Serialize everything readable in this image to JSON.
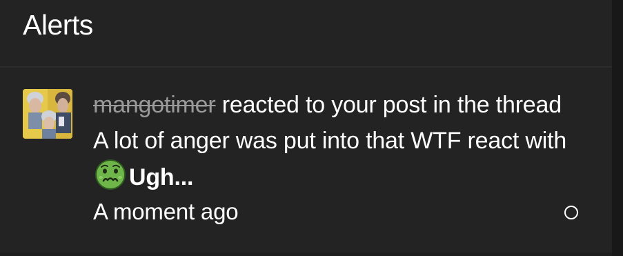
{
  "header": {
    "title": "Alerts"
  },
  "alerts": [
    {
      "username": "mangotimer",
      "text_before_thread": " reacted to your post in the thread ",
      "thread_title": "A lot of anger was put into that WTF",
      "text_before_reaction": " react with ",
      "reaction_icon": "nauseated-face-icon",
      "reaction_name": "Ugh...",
      "timestamp": "A moment ago",
      "read_state": "unread"
    }
  ],
  "colors": {
    "background": "#232323",
    "text": "#ffffff",
    "muted_username": "#9a9a9a",
    "emoji_face": "#6fb64a"
  }
}
